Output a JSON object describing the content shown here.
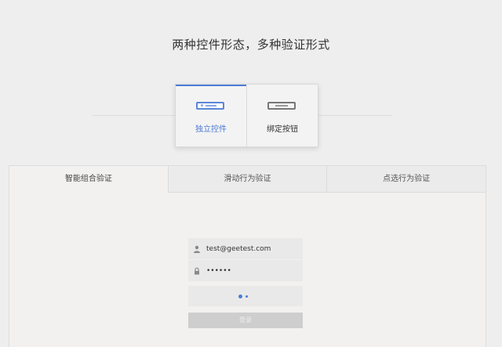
{
  "headline": "两种控件形态，多种验证形式",
  "modes": [
    {
      "label": "独立控件",
      "icon": "input-bar-icon",
      "active": true
    },
    {
      "label": "绑定按钮",
      "icon": "button-bar-icon",
      "active": false
    }
  ],
  "tabs": [
    {
      "label": "智能组合验证",
      "active": true
    },
    {
      "label": "滑动行为验证",
      "active": false
    },
    {
      "label": "点选行为验证",
      "active": false
    }
  ],
  "form": {
    "username": "test@geetest.com",
    "password": "••••••",
    "submit_label": "登录"
  },
  "colors": {
    "accent": "#4a7bd6",
    "background": "#efeeee"
  }
}
